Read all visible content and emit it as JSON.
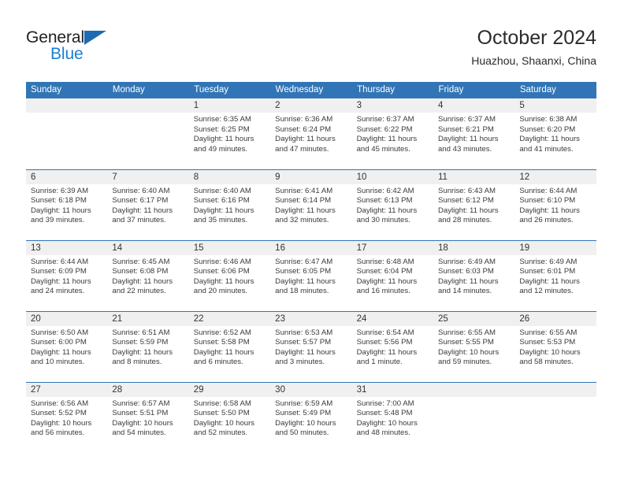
{
  "brand": {
    "name_part1": "General",
    "name_part2": "Blue",
    "accent_color": "#1b7fd4",
    "triangle_color": "#1b6cb3"
  },
  "header": {
    "title": "October 2024",
    "subtitle": "Huazhou, Shaanxi, China"
  },
  "theme": {
    "header_blue": "#3275b6",
    "daynum_band": "#f0f0f0",
    "text": "#3a3a3a"
  },
  "weekday_headers": [
    "Sunday",
    "Monday",
    "Tuesday",
    "Wednesday",
    "Thursday",
    "Friday",
    "Saturday"
  ],
  "weeks": [
    [
      {
        "day": "",
        "sunrise": "",
        "sunset": "",
        "daylight_line1": "",
        "daylight_line2": ""
      },
      {
        "day": "",
        "sunrise": "",
        "sunset": "",
        "daylight_line1": "",
        "daylight_line2": ""
      },
      {
        "day": "1",
        "sunrise": "Sunrise: 6:35 AM",
        "sunset": "Sunset: 6:25 PM",
        "daylight_line1": "Daylight: 11 hours",
        "daylight_line2": "and 49 minutes."
      },
      {
        "day": "2",
        "sunrise": "Sunrise: 6:36 AM",
        "sunset": "Sunset: 6:24 PM",
        "daylight_line1": "Daylight: 11 hours",
        "daylight_line2": "and 47 minutes."
      },
      {
        "day": "3",
        "sunrise": "Sunrise: 6:37 AM",
        "sunset": "Sunset: 6:22 PM",
        "daylight_line1": "Daylight: 11 hours",
        "daylight_line2": "and 45 minutes."
      },
      {
        "day": "4",
        "sunrise": "Sunrise: 6:37 AM",
        "sunset": "Sunset: 6:21 PM",
        "daylight_line1": "Daylight: 11 hours",
        "daylight_line2": "and 43 minutes."
      },
      {
        "day": "5",
        "sunrise": "Sunrise: 6:38 AM",
        "sunset": "Sunset: 6:20 PM",
        "daylight_line1": "Daylight: 11 hours",
        "daylight_line2": "and 41 minutes."
      }
    ],
    [
      {
        "day": "6",
        "sunrise": "Sunrise: 6:39 AM",
        "sunset": "Sunset: 6:18 PM",
        "daylight_line1": "Daylight: 11 hours",
        "daylight_line2": "and 39 minutes."
      },
      {
        "day": "7",
        "sunrise": "Sunrise: 6:40 AM",
        "sunset": "Sunset: 6:17 PM",
        "daylight_line1": "Daylight: 11 hours",
        "daylight_line2": "and 37 minutes."
      },
      {
        "day": "8",
        "sunrise": "Sunrise: 6:40 AM",
        "sunset": "Sunset: 6:16 PM",
        "daylight_line1": "Daylight: 11 hours",
        "daylight_line2": "and 35 minutes."
      },
      {
        "day": "9",
        "sunrise": "Sunrise: 6:41 AM",
        "sunset": "Sunset: 6:14 PM",
        "daylight_line1": "Daylight: 11 hours",
        "daylight_line2": "and 32 minutes."
      },
      {
        "day": "10",
        "sunrise": "Sunrise: 6:42 AM",
        "sunset": "Sunset: 6:13 PM",
        "daylight_line1": "Daylight: 11 hours",
        "daylight_line2": "and 30 minutes."
      },
      {
        "day": "11",
        "sunrise": "Sunrise: 6:43 AM",
        "sunset": "Sunset: 6:12 PM",
        "daylight_line1": "Daylight: 11 hours",
        "daylight_line2": "and 28 minutes."
      },
      {
        "day": "12",
        "sunrise": "Sunrise: 6:44 AM",
        "sunset": "Sunset: 6:10 PM",
        "daylight_line1": "Daylight: 11 hours",
        "daylight_line2": "and 26 minutes."
      }
    ],
    [
      {
        "day": "13",
        "sunrise": "Sunrise: 6:44 AM",
        "sunset": "Sunset: 6:09 PM",
        "daylight_line1": "Daylight: 11 hours",
        "daylight_line2": "and 24 minutes."
      },
      {
        "day": "14",
        "sunrise": "Sunrise: 6:45 AM",
        "sunset": "Sunset: 6:08 PM",
        "daylight_line1": "Daylight: 11 hours",
        "daylight_line2": "and 22 minutes."
      },
      {
        "day": "15",
        "sunrise": "Sunrise: 6:46 AM",
        "sunset": "Sunset: 6:06 PM",
        "daylight_line1": "Daylight: 11 hours",
        "daylight_line2": "and 20 minutes."
      },
      {
        "day": "16",
        "sunrise": "Sunrise: 6:47 AM",
        "sunset": "Sunset: 6:05 PM",
        "daylight_line1": "Daylight: 11 hours",
        "daylight_line2": "and 18 minutes."
      },
      {
        "day": "17",
        "sunrise": "Sunrise: 6:48 AM",
        "sunset": "Sunset: 6:04 PM",
        "daylight_line1": "Daylight: 11 hours",
        "daylight_line2": "and 16 minutes."
      },
      {
        "day": "18",
        "sunrise": "Sunrise: 6:49 AM",
        "sunset": "Sunset: 6:03 PM",
        "daylight_line1": "Daylight: 11 hours",
        "daylight_line2": "and 14 minutes."
      },
      {
        "day": "19",
        "sunrise": "Sunrise: 6:49 AM",
        "sunset": "Sunset: 6:01 PM",
        "daylight_line1": "Daylight: 11 hours",
        "daylight_line2": "and 12 minutes."
      }
    ],
    [
      {
        "day": "20",
        "sunrise": "Sunrise: 6:50 AM",
        "sunset": "Sunset: 6:00 PM",
        "daylight_line1": "Daylight: 11 hours",
        "daylight_line2": "and 10 minutes."
      },
      {
        "day": "21",
        "sunrise": "Sunrise: 6:51 AM",
        "sunset": "Sunset: 5:59 PM",
        "daylight_line1": "Daylight: 11 hours",
        "daylight_line2": "and 8 minutes."
      },
      {
        "day": "22",
        "sunrise": "Sunrise: 6:52 AM",
        "sunset": "Sunset: 5:58 PM",
        "daylight_line1": "Daylight: 11 hours",
        "daylight_line2": "and 6 minutes."
      },
      {
        "day": "23",
        "sunrise": "Sunrise: 6:53 AM",
        "sunset": "Sunset: 5:57 PM",
        "daylight_line1": "Daylight: 11 hours",
        "daylight_line2": "and 3 minutes."
      },
      {
        "day": "24",
        "sunrise": "Sunrise: 6:54 AM",
        "sunset": "Sunset: 5:56 PM",
        "daylight_line1": "Daylight: 11 hours",
        "daylight_line2": "and 1 minute."
      },
      {
        "day": "25",
        "sunrise": "Sunrise: 6:55 AM",
        "sunset": "Sunset: 5:55 PM",
        "daylight_line1": "Daylight: 10 hours",
        "daylight_line2": "and 59 minutes."
      },
      {
        "day": "26",
        "sunrise": "Sunrise: 6:55 AM",
        "sunset": "Sunset: 5:53 PM",
        "daylight_line1": "Daylight: 10 hours",
        "daylight_line2": "and 58 minutes."
      }
    ],
    [
      {
        "day": "27",
        "sunrise": "Sunrise: 6:56 AM",
        "sunset": "Sunset: 5:52 PM",
        "daylight_line1": "Daylight: 10 hours",
        "daylight_line2": "and 56 minutes."
      },
      {
        "day": "28",
        "sunrise": "Sunrise: 6:57 AM",
        "sunset": "Sunset: 5:51 PM",
        "daylight_line1": "Daylight: 10 hours",
        "daylight_line2": "and 54 minutes."
      },
      {
        "day": "29",
        "sunrise": "Sunrise: 6:58 AM",
        "sunset": "Sunset: 5:50 PM",
        "daylight_line1": "Daylight: 10 hours",
        "daylight_line2": "and 52 minutes."
      },
      {
        "day": "30",
        "sunrise": "Sunrise: 6:59 AM",
        "sunset": "Sunset: 5:49 PM",
        "daylight_line1": "Daylight: 10 hours",
        "daylight_line2": "and 50 minutes."
      },
      {
        "day": "31",
        "sunrise": "Sunrise: 7:00 AM",
        "sunset": "Sunset: 5:48 PM",
        "daylight_line1": "Daylight: 10 hours",
        "daylight_line2": "and 48 minutes."
      },
      {
        "day": "",
        "sunrise": "",
        "sunset": "",
        "daylight_line1": "",
        "daylight_line2": ""
      },
      {
        "day": "",
        "sunrise": "",
        "sunset": "",
        "daylight_line1": "",
        "daylight_line2": ""
      }
    ]
  ]
}
